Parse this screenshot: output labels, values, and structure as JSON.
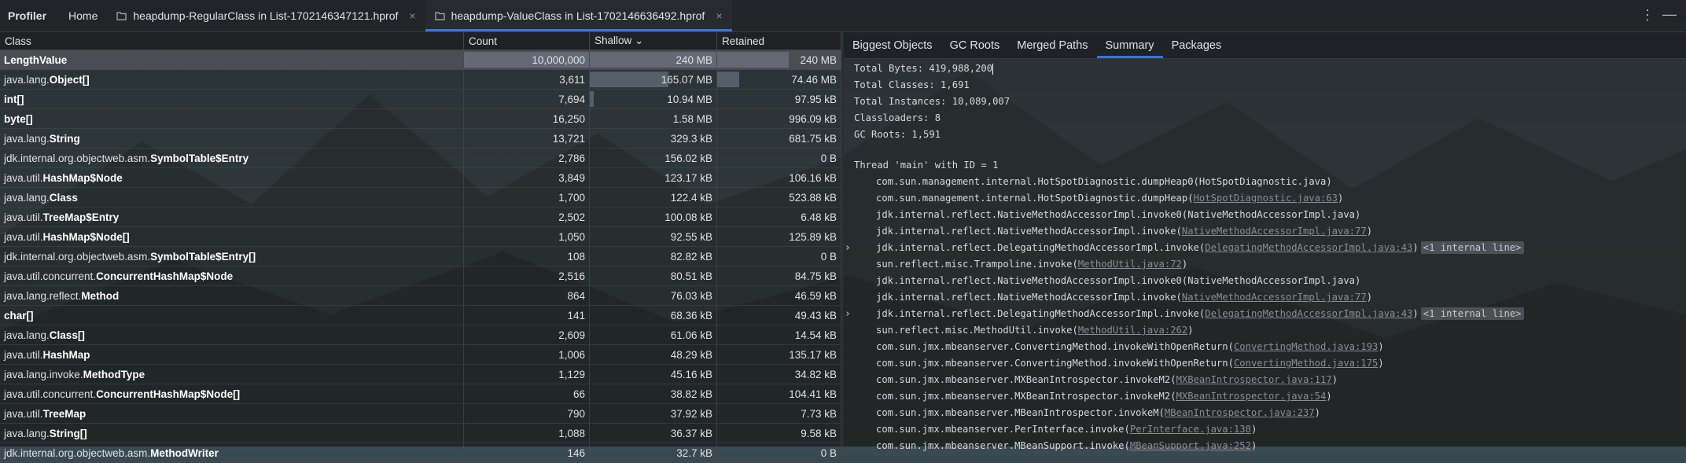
{
  "topbar": {
    "brand": "Profiler",
    "home": "Home",
    "tabs": [
      {
        "label": "heapdump-RegularClass in List-1702146347121.hprof"
      },
      {
        "label": "heapdump-ValueClass in List-1702146636492.hprof"
      }
    ],
    "kebab": "⋮",
    "minimize": "—"
  },
  "table": {
    "headers": {
      "class": "Class",
      "count": "Count",
      "shallow": "Shallow ⌄",
      "retained": "Retained"
    },
    "rows": [
      {
        "pkg": "",
        "name": "LengthValue",
        "count": "10,000,000",
        "shallow": "240 MB",
        "retained": "240 MB",
        "shallow_frac": 1.0,
        "retained_frac": 0.58
      },
      {
        "pkg": "java.lang.",
        "name": "Object[]",
        "count": "3,611",
        "shallow": "165.07 MB",
        "retained": "74.46 MB",
        "shallow_frac": 0.62,
        "retained_frac": 0.18
      },
      {
        "pkg": "",
        "name": "int[]",
        "count": "7,694",
        "shallow": "10.94 MB",
        "retained": "97.95 kB",
        "shallow_frac": 0.03,
        "retained_frac": 0
      },
      {
        "pkg": "",
        "name": "byte[]",
        "count": "16,250",
        "shallow": "1.58 MB",
        "retained": "996.09 kB",
        "shallow_frac": 0,
        "retained_frac": 0
      },
      {
        "pkg": "java.lang.",
        "name": "String",
        "count": "13,721",
        "shallow": "329.3 kB",
        "retained": "681.75 kB",
        "shallow_frac": 0,
        "retained_frac": 0
      },
      {
        "pkg": "jdk.internal.org.objectweb.asm.",
        "name": "SymbolTable$Entry",
        "count": "2,786",
        "shallow": "156.02 kB",
        "retained": "0 B",
        "shallow_frac": 0,
        "retained_frac": 0
      },
      {
        "pkg": "java.util.",
        "name": "HashMap$Node",
        "count": "3,849",
        "shallow": "123.17 kB",
        "retained": "106.16 kB",
        "shallow_frac": 0,
        "retained_frac": 0
      },
      {
        "pkg": "java.lang.",
        "name": "Class",
        "count": "1,700",
        "shallow": "122.4 kB",
        "retained": "523.88 kB",
        "shallow_frac": 0,
        "retained_frac": 0
      },
      {
        "pkg": "java.util.",
        "name": "TreeMap$Entry",
        "count": "2,502",
        "shallow": "100.08 kB",
        "retained": "6.48 kB",
        "shallow_frac": 0,
        "retained_frac": 0
      },
      {
        "pkg": "java.util.",
        "name": "HashMap$Node[]",
        "count": "1,050",
        "shallow": "92.55 kB",
        "retained": "125.89 kB",
        "shallow_frac": 0,
        "retained_frac": 0
      },
      {
        "pkg": "jdk.internal.org.objectweb.asm.",
        "name": "SymbolTable$Entry[]",
        "count": "108",
        "shallow": "82.82 kB",
        "retained": "0 B",
        "shallow_frac": 0,
        "retained_frac": 0
      },
      {
        "pkg": "java.util.concurrent.",
        "name": "ConcurrentHashMap$Node",
        "count": "2,516",
        "shallow": "80.51 kB",
        "retained": "84.75 kB",
        "shallow_frac": 0,
        "retained_frac": 0
      },
      {
        "pkg": "java.lang.reflect.",
        "name": "Method",
        "count": "864",
        "shallow": "76.03 kB",
        "retained": "46.59 kB",
        "shallow_frac": 0,
        "retained_frac": 0
      },
      {
        "pkg": "",
        "name": "char[]",
        "count": "141",
        "shallow": "68.36 kB",
        "retained": "49.43 kB",
        "shallow_frac": 0,
        "retained_frac": 0
      },
      {
        "pkg": "java.lang.",
        "name": "Class[]",
        "count": "2,609",
        "shallow": "61.06 kB",
        "retained": "14.54 kB",
        "shallow_frac": 0,
        "retained_frac": 0
      },
      {
        "pkg": "java.util.",
        "name": "HashMap",
        "count": "1,006",
        "shallow": "48.29 kB",
        "retained": "135.17 kB",
        "shallow_frac": 0,
        "retained_frac": 0
      },
      {
        "pkg": "java.lang.invoke.",
        "name": "MethodType",
        "count": "1,129",
        "shallow": "45.16 kB",
        "retained": "34.82 kB",
        "shallow_frac": 0,
        "retained_frac": 0
      },
      {
        "pkg": "java.util.concurrent.",
        "name": "ConcurrentHashMap$Node[]",
        "count": "66",
        "shallow": "38.82 kB",
        "retained": "104.41 kB",
        "shallow_frac": 0,
        "retained_frac": 0
      },
      {
        "pkg": "java.util.",
        "name": "TreeMap",
        "count": "790",
        "shallow": "37.92 kB",
        "retained": "7.73 kB",
        "shallow_frac": 0,
        "retained_frac": 0
      },
      {
        "pkg": "java.lang.",
        "name": "String[]",
        "count": "1,088",
        "shallow": "36.37 kB",
        "retained": "9.58 kB",
        "shallow_frac": 0,
        "retained_frac": 0
      },
      {
        "pkg": "jdk.internal.org.objectweb.asm.",
        "name": "MethodWriter",
        "count": "146",
        "shallow": "32.7 kB",
        "retained": "0 B",
        "shallow_frac": 0,
        "retained_frac": 0
      }
    ]
  },
  "right": {
    "tabs": [
      "Biggest Objects",
      "GC Roots",
      "Merged Paths",
      "Summary",
      "Packages"
    ],
    "active_tab": "Summary",
    "summary": [
      "Total Bytes: 419,988,200",
      "Total Classes: 1,691",
      "Total Instances: 10,089,007",
      "Classloaders: 8",
      "GC Roots: 1,591"
    ],
    "thread_header": "Thread 'main' with ID = 1",
    "frames": [
      {
        "text": "com.sun.management.internal.HotSpotDiagnostic.dumpHeap0(",
        "link": "",
        "tail": "HotSpotDiagnostic.java)",
        "internal": "",
        "chevron": false
      },
      {
        "text": "com.sun.management.internal.HotSpotDiagnostic.dumpHeap(",
        "link": "HotSpotDiagnostic.java:63",
        "tail": ")",
        "internal": "",
        "chevron": false
      },
      {
        "text": "jdk.internal.reflect.NativeMethodAccessorImpl.invoke0(",
        "link": "",
        "tail": "NativeMethodAccessorImpl.java)",
        "internal": "",
        "chevron": false
      },
      {
        "text": "jdk.internal.reflect.NativeMethodAccessorImpl.invoke(",
        "link": "NativeMethodAccessorImpl.java:77",
        "tail": ")",
        "internal": "",
        "chevron": false
      },
      {
        "text": "jdk.internal.reflect.DelegatingMethodAccessorImpl.invoke(",
        "link": "DelegatingMethodAccessorImpl.java:43",
        "tail": ")",
        "internal": "<1 internal line>",
        "chevron": true
      },
      {
        "text": "sun.reflect.misc.Trampoline.invoke(",
        "link": "MethodUtil.java:72",
        "tail": ")",
        "internal": "",
        "chevron": false
      },
      {
        "text": "jdk.internal.reflect.NativeMethodAccessorImpl.invoke0(",
        "link": "",
        "tail": "NativeMethodAccessorImpl.java)",
        "internal": "",
        "chevron": false
      },
      {
        "text": "jdk.internal.reflect.NativeMethodAccessorImpl.invoke(",
        "link": "NativeMethodAccessorImpl.java:77",
        "tail": ")",
        "internal": "",
        "chevron": false
      },
      {
        "text": "jdk.internal.reflect.DelegatingMethodAccessorImpl.invoke(",
        "link": "DelegatingMethodAccessorImpl.java:43",
        "tail": ")",
        "internal": "<1 internal line>",
        "chevron": true
      },
      {
        "text": "sun.reflect.misc.MethodUtil.invoke(",
        "link": "MethodUtil.java:262",
        "tail": ")",
        "internal": "",
        "chevron": false
      },
      {
        "text": "com.sun.jmx.mbeanserver.ConvertingMethod.invokeWithOpenReturn(",
        "link": "ConvertingMethod.java:193",
        "tail": ")",
        "internal": "",
        "chevron": false
      },
      {
        "text": "com.sun.jmx.mbeanserver.ConvertingMethod.invokeWithOpenReturn(",
        "link": "ConvertingMethod.java:175",
        "tail": ")",
        "internal": "",
        "chevron": false
      },
      {
        "text": "com.sun.jmx.mbeanserver.MXBeanIntrospector.invokeM2(",
        "link": "MXBeanIntrospector.java:117",
        "tail": ")",
        "internal": "",
        "chevron": false
      },
      {
        "text": "com.sun.jmx.mbeanserver.MXBeanIntrospector.invokeM2(",
        "link": "MXBeanIntrospector.java:54",
        "tail": ")",
        "internal": "",
        "chevron": false
      },
      {
        "text": "com.sun.jmx.mbeanserver.MBeanIntrospector.invokeM(",
        "link": "MBeanIntrospector.java:237",
        "tail": ")",
        "internal": "",
        "chevron": false
      },
      {
        "text": "com.sun.jmx.mbeanserver.PerInterface.invoke(",
        "link": "PerInterface.java:138",
        "tail": ")",
        "internal": "",
        "chevron": false
      },
      {
        "text": "com.sun.jmx.mbeanserver.MBeanSupport.invoke(",
        "link": "MBeanSupport.java:252",
        "tail": ")",
        "internal": "",
        "chevron": false
      }
    ]
  },
  "colors": {
    "accent": "#3574f0",
    "text": "#dfe1e5",
    "muted": "#8a8d92"
  }
}
